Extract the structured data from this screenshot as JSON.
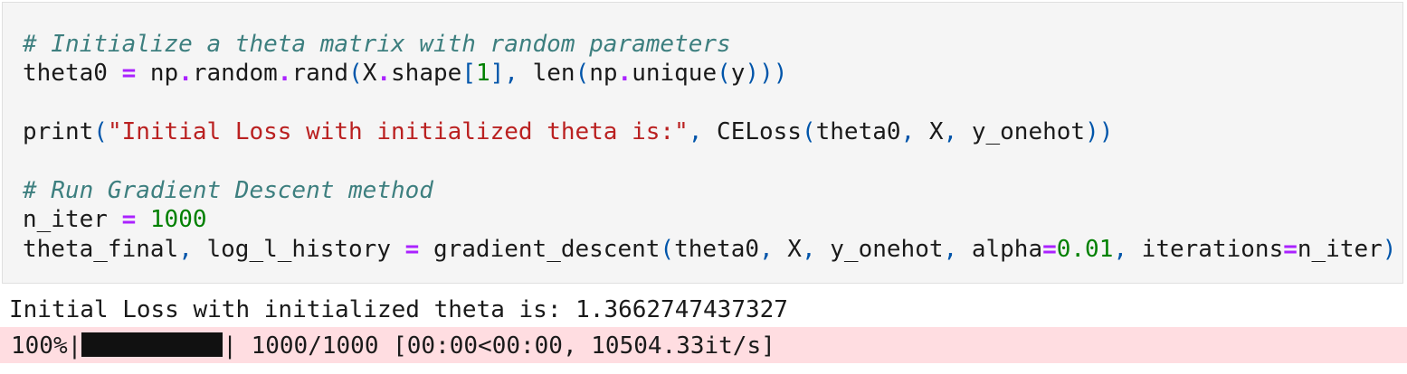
{
  "input_cell": {
    "lines": [
      [
        {
          "t": "# Initialize a theta matrix with random parameters",
          "c": "cm"
        }
      ],
      [
        {
          "t": "theta0 ",
          "c": "nm"
        },
        {
          "t": "=",
          "c": "op"
        },
        {
          "t": " np",
          "c": "nm"
        },
        {
          "t": ".",
          "c": "op"
        },
        {
          "t": "random",
          "c": "nm"
        },
        {
          "t": ".",
          "c": "op"
        },
        {
          "t": "rand",
          "c": "nm"
        },
        {
          "t": "(",
          "c": "pa"
        },
        {
          "t": "X",
          "c": "nm"
        },
        {
          "t": ".",
          "c": "op"
        },
        {
          "t": "shape",
          "c": "nm"
        },
        {
          "t": "[",
          "c": "pa"
        },
        {
          "t": "1",
          "c": "num"
        },
        {
          "t": "],",
          "c": "pa"
        },
        {
          "t": " len",
          "c": "nm"
        },
        {
          "t": "(",
          "c": "pa"
        },
        {
          "t": "np",
          "c": "nm"
        },
        {
          "t": ".",
          "c": "op"
        },
        {
          "t": "unique",
          "c": "nm"
        },
        {
          "t": "(",
          "c": "pa"
        },
        {
          "t": "y",
          "c": "nm"
        },
        {
          "t": ")))",
          "c": "pa"
        }
      ],
      [],
      [
        {
          "t": "print",
          "c": "nm"
        },
        {
          "t": "(",
          "c": "pa"
        },
        {
          "t": "\"Initial Loss with initialized theta is:\"",
          "c": "str"
        },
        {
          "t": ",",
          "c": "pa"
        },
        {
          "t": " CELoss",
          "c": "nm"
        },
        {
          "t": "(",
          "c": "pa"
        },
        {
          "t": "theta0",
          "c": "nm"
        },
        {
          "t": ",",
          "c": "pa"
        },
        {
          "t": " X",
          "c": "nm"
        },
        {
          "t": ",",
          "c": "pa"
        },
        {
          "t": " y_onehot",
          "c": "nm"
        },
        {
          "t": "))",
          "c": "pa"
        }
      ],
      [],
      [
        {
          "t": "# Run Gradient Descent method",
          "c": "cm"
        }
      ],
      [
        {
          "t": "n_iter ",
          "c": "nm"
        },
        {
          "t": "=",
          "c": "op"
        },
        {
          "t": " 1000",
          "c": "num"
        }
      ],
      [
        {
          "t": "theta_final",
          "c": "nm"
        },
        {
          "t": ",",
          "c": "pa"
        },
        {
          "t": " log_l_history ",
          "c": "nm"
        },
        {
          "t": "=",
          "c": "op"
        },
        {
          "t": " gradient_descent",
          "c": "nm"
        },
        {
          "t": "(",
          "c": "pa"
        },
        {
          "t": "theta0",
          "c": "nm"
        },
        {
          "t": ",",
          "c": "pa"
        },
        {
          "t": " X",
          "c": "nm"
        },
        {
          "t": ",",
          "c": "pa"
        },
        {
          "t": " y_onehot",
          "c": "nm"
        },
        {
          "t": ",",
          "c": "pa"
        },
        {
          "t": " alpha",
          "c": "nm"
        },
        {
          "t": "=",
          "c": "op"
        },
        {
          "t": "0.01",
          "c": "num"
        },
        {
          "t": ",",
          "c": "pa"
        },
        {
          "t": " iterations",
          "c": "nm"
        },
        {
          "t": "=",
          "c": "op"
        },
        {
          "t": "n_iter",
          "c": "nm"
        },
        {
          "t": ")",
          "c": "pa"
        }
      ]
    ]
  },
  "output": {
    "stdout_text": "Initial Loss with initialized theta is: 1.3662747437327",
    "progress": {
      "percent_label": "100%|",
      "fraction": 1.0,
      "suffix": "| 1000/1000 [00:00<00:00, 10504.33it/s]"
    }
  },
  "colors": {
    "cell_background": "#f5f5f5",
    "stderr_background": "#ffdde1",
    "comment": "#3d7f7f",
    "operator": "#aa22ff",
    "number": "#008000",
    "string": "#ba2121",
    "punctuation": "#0055aa"
  }
}
